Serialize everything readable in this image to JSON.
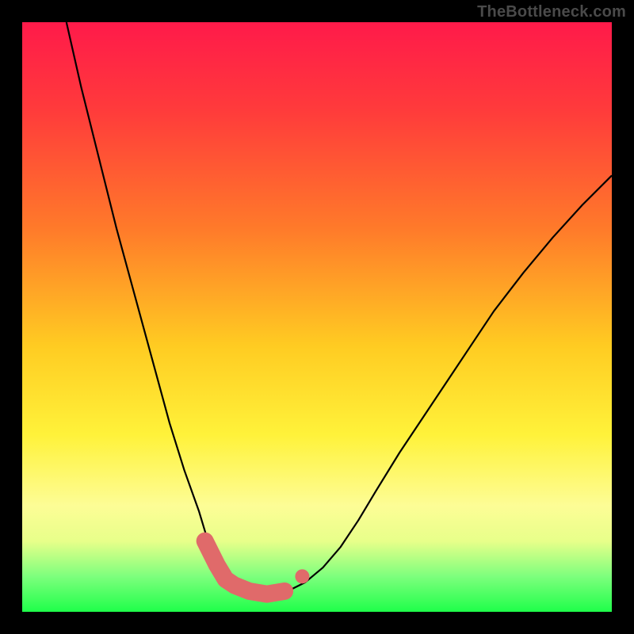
{
  "watermark": "TheBottleneck.com",
  "chart_data": {
    "type": "line",
    "title": "",
    "xlabel": "",
    "ylabel": "",
    "xlim": [
      0,
      1
    ],
    "ylim": [
      0,
      1
    ],
    "note": "Axes have no tick labels in the source image; values are normalized 0–1 estimates from pixel positions. y=1 is top of plot, y=0 is bottom.",
    "series": [
      {
        "name": "curve",
        "x": [
          0.075,
          0.1,
          0.13,
          0.16,
          0.19,
          0.22,
          0.25,
          0.275,
          0.3,
          0.315,
          0.33,
          0.345,
          0.36,
          0.38,
          0.4,
          0.42,
          0.45,
          0.48,
          0.51,
          0.54,
          0.57,
          0.6,
          0.64,
          0.68,
          0.72,
          0.76,
          0.8,
          0.85,
          0.9,
          0.95,
          1.0
        ],
        "y": [
          1.0,
          0.89,
          0.77,
          0.65,
          0.54,
          0.43,
          0.32,
          0.24,
          0.17,
          0.12,
          0.085,
          0.06,
          0.045,
          0.035,
          0.03,
          0.03,
          0.035,
          0.05,
          0.075,
          0.11,
          0.155,
          0.205,
          0.27,
          0.33,
          0.39,
          0.45,
          0.51,
          0.575,
          0.635,
          0.69,
          0.74
        ]
      }
    ],
    "markers": {
      "name": "highlighted-bottom-segment",
      "color": "#e06a6a",
      "points_x": [
        0.31,
        0.33,
        0.345,
        0.36,
        0.385,
        0.415,
        0.445
      ],
      "points_y": [
        0.12,
        0.08,
        0.055,
        0.045,
        0.035,
        0.03,
        0.035
      ],
      "extra_dot": {
        "x": 0.475,
        "y": 0.06
      }
    }
  }
}
